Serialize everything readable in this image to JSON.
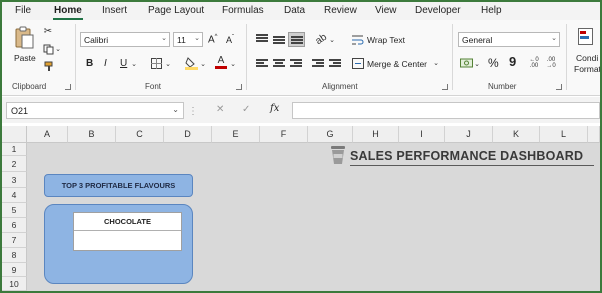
{
  "menu": {
    "tabs": [
      {
        "label": "File"
      },
      {
        "label": "Home"
      },
      {
        "label": "Insert"
      },
      {
        "label": "Page Layout"
      },
      {
        "label": "Formulas"
      },
      {
        "label": "Data"
      },
      {
        "label": "Review"
      },
      {
        "label": "View"
      },
      {
        "label": "Developer"
      },
      {
        "label": "Help"
      }
    ],
    "active": "Home"
  },
  "ribbon": {
    "clipboard": {
      "paste_label": "Paste",
      "group_label": "Clipboard"
    },
    "font": {
      "font_name": "Calibri",
      "font_size": "11",
      "bold": "B",
      "italic": "I",
      "underline": "U",
      "increase": "A",
      "decrease": "A",
      "group_label": "Font",
      "font_color": "#c00000"
    },
    "alignment": {
      "wrap_text": "Wrap Text",
      "merge_center": "Merge & Center",
      "group_label": "Alignment"
    },
    "number": {
      "format": "General",
      "currency": "$",
      "percent": "%",
      "comma": "9",
      "group_label": "Number"
    },
    "styles": {
      "cond_format_line1": "Condi",
      "cond_format_line2": "Format"
    }
  },
  "formula_bar": {
    "name_box": "O21",
    "cancel": "✕",
    "enter": "✓",
    "fx": "fx",
    "value": ""
  },
  "grid": {
    "columns": [
      "A",
      "B",
      "C",
      "D",
      "E",
      "F",
      "G",
      "H",
      "I",
      "J",
      "K",
      "L"
    ],
    "rows": [
      "1",
      "2",
      "3",
      "4",
      "5",
      "6",
      "7",
      "8",
      "9",
      "10"
    ]
  },
  "dashboard": {
    "title": "SALES PERFORMANCE DASHBOARD",
    "card_label": "TOP 3 PROFITABLE FLAVOURS",
    "flavour": "CHOCOLATE",
    "card_color": "#8eb4e3",
    "accent": "#217346"
  }
}
